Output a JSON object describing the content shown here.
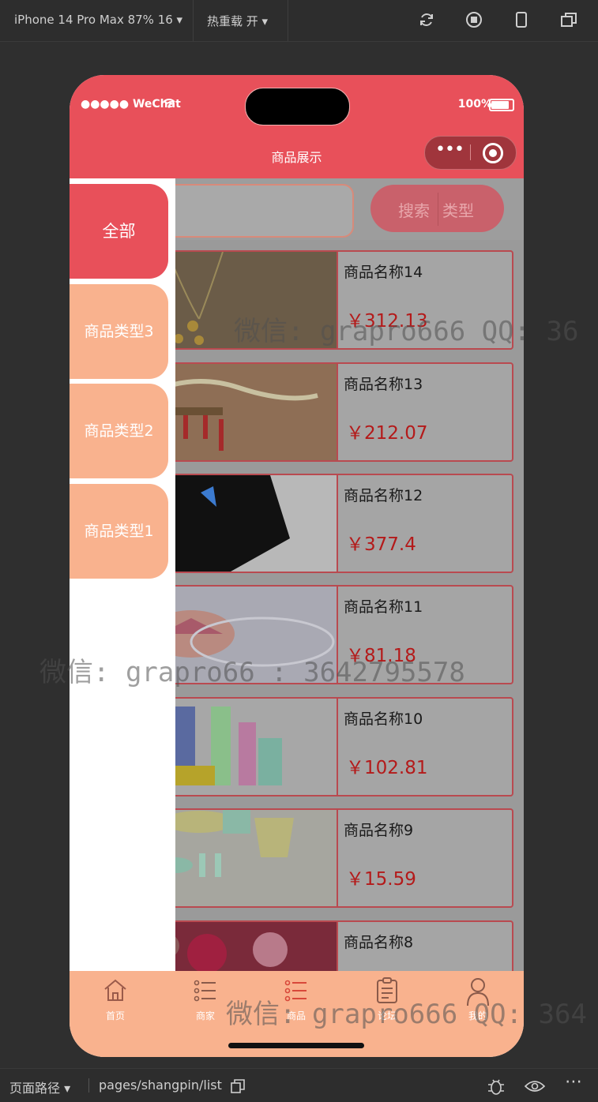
{
  "toolbar": {
    "device_label": "iPhone 14 Pro Max 87% 16 ▾",
    "hot_reload_label": "热重载 开 ▾"
  },
  "status_bar": {
    "carrier": "●●●●● WeChat",
    "battery": "100%"
  },
  "navbar": {
    "title": "商品展示"
  },
  "search": {
    "search_label": "搜索",
    "type_label": "类型"
  },
  "categories": [
    {
      "label": "全部"
    },
    {
      "label": "商品类型3"
    },
    {
      "label": "商品类型2"
    },
    {
      "label": "商品类型1"
    }
  ],
  "products": [
    {
      "name": "商品名称14",
      "price": "￥312.13"
    },
    {
      "name": "商品名称13",
      "price": "￥212.07"
    },
    {
      "name": "商品名称12",
      "price": "￥377.4"
    },
    {
      "name": "商品名称11",
      "price": "￥81.18"
    },
    {
      "name": "商品名称10",
      "price": "￥102.81"
    },
    {
      "name": "商品名称9",
      "price": "￥15.59"
    },
    {
      "name": "商品名称8",
      "price": ""
    }
  ],
  "tabbar": [
    {
      "label": "首页",
      "icon": "home-icon"
    },
    {
      "label": "商家",
      "icon": "list-icon"
    },
    {
      "label": "商品",
      "icon": "list-icon"
    },
    {
      "label": "论坛",
      "icon": "clipboard-icon"
    },
    {
      "label": "我的",
      "icon": "person-icon"
    }
  ],
  "bottom_bar": {
    "path_label": "页面路径 ▾",
    "path_value": "pages/shangpin/list"
  },
  "watermarks": [
    "微信: grapro666 QQ: 36",
    "微信: grapro66 : 3642795578",
    "微信: grapro666 QQ: 364"
  ],
  "colors": {
    "primary": "#e8505a",
    "secondary": "#f9b28e",
    "price": "#b41a1a"
  }
}
